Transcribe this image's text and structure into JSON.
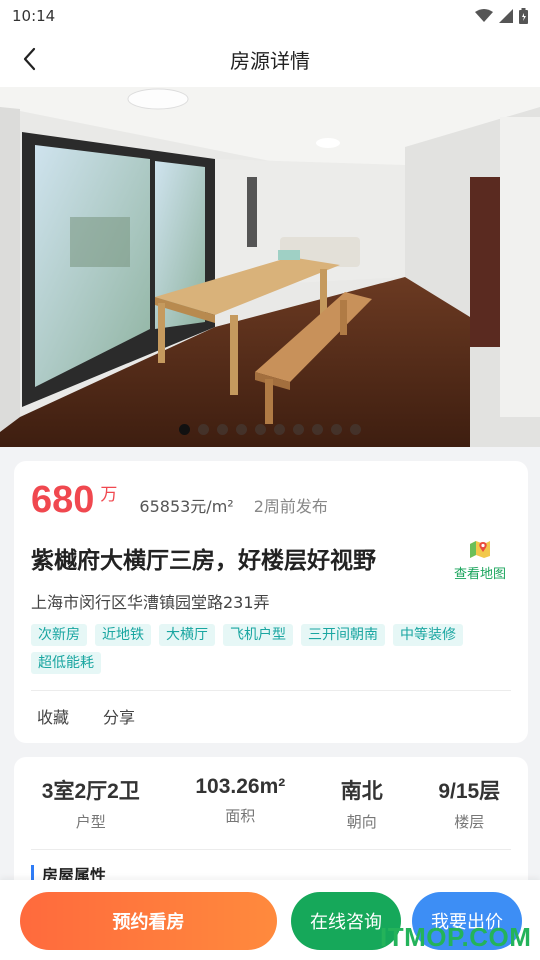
{
  "status": {
    "time": "10:14"
  },
  "nav": {
    "title": "房源详情"
  },
  "gallery": {
    "total": 10,
    "active": 0
  },
  "listing": {
    "price": "680",
    "price_unit": "万",
    "unit_price": "65853元/m²",
    "published": "2周前发布",
    "title": "紫樾府大横厅三房，好楼层好视野",
    "map_label": "查看地图",
    "address": "上海市闵行区华漕镇园堂路231弄",
    "tags": [
      "次新房",
      "近地铁",
      "大横厅",
      "飞机户型",
      "三开间朝南",
      "中等装修",
      "超低能耗"
    ],
    "actions": {
      "favorite": "收藏",
      "share": "分享"
    }
  },
  "specs": [
    {
      "value": "3室2厅2卫",
      "label": "户型"
    },
    {
      "value": "103.26m²",
      "label": "面积"
    },
    {
      "value": "南北",
      "label": "朝向"
    },
    {
      "value": "9/15层",
      "label": "楼层"
    }
  ],
  "section": {
    "title": "房屋属性"
  },
  "bottom": {
    "book": "预约看房",
    "chat": "在线咨询",
    "offer": "我要出价"
  },
  "watermark": "ITMOP.COM",
  "colors": {
    "price": "#f0484f",
    "tag_text": "#1aa6a1",
    "tag_bg": "#e6f7f6",
    "map_green": "#19a45b",
    "book_btn": "#ff7a3d",
    "chat_btn": "#16a85a",
    "offer_btn": "#3d8ef5"
  }
}
